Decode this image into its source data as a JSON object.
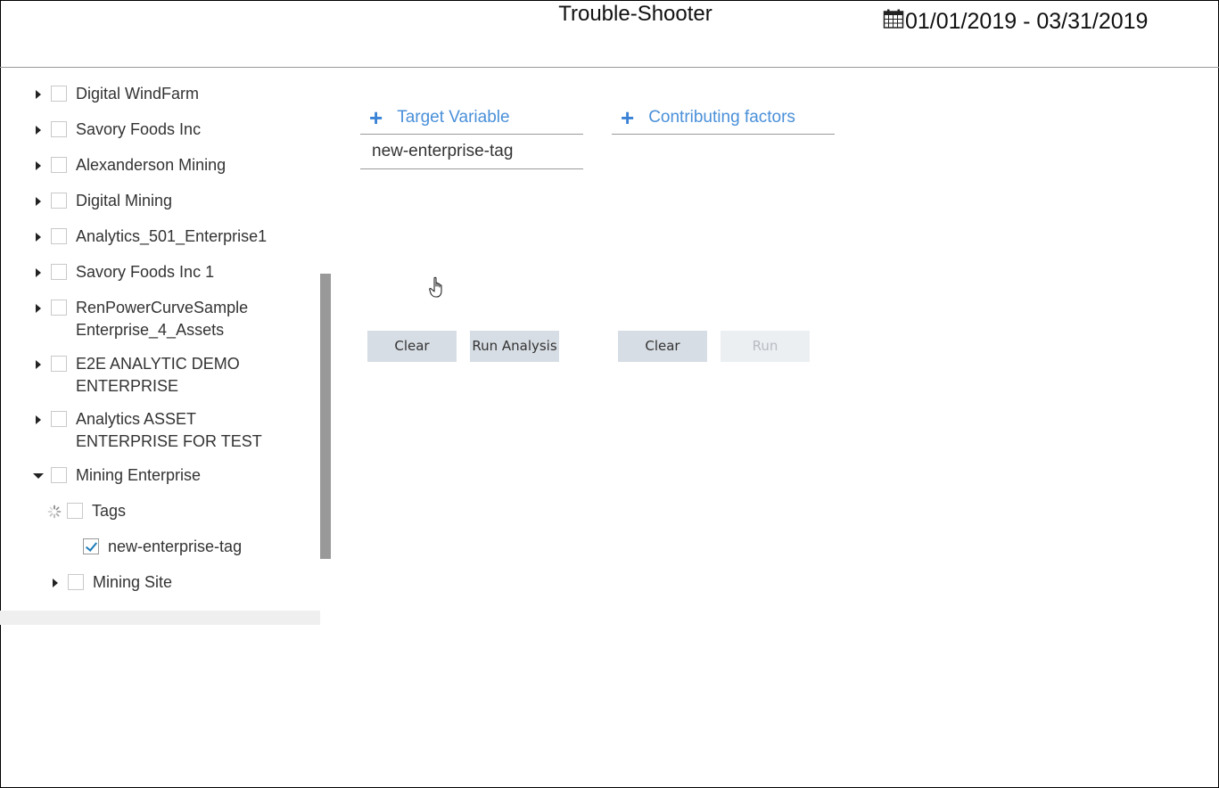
{
  "header": {
    "title": "Trouble-Shooter",
    "date_range": "01/01/2019 - 03/31/2019"
  },
  "tree": {
    "items": [
      {
        "label": "Digital WindFarm",
        "checked": false,
        "expanded": false
      },
      {
        "label": "Savory Foods Inc",
        "checked": false,
        "expanded": false
      },
      {
        "label": "Alexanderson Mining",
        "checked": false,
        "expanded": false
      },
      {
        "label": "Digital Mining",
        "checked": false,
        "expanded": false
      },
      {
        "label": "Analytics_501_Enterprise1",
        "checked": false,
        "expanded": false
      },
      {
        "label": "Savory Foods Inc 1",
        "checked": false,
        "expanded": false
      },
      {
        "label": "RenPowerCurveSample Enterprise_4_Assets",
        "line1": "RenPowerCurveSample",
        "line2": "Enterprise_4_Assets",
        "checked": false,
        "expanded": false
      },
      {
        "label": "E2E ANALYTIC DEMO ENTERPRISE",
        "line1": "E2E ANALYTIC DEMO",
        "line2": "ENTERPRISE",
        "checked": false,
        "expanded": false
      },
      {
        "label": "Analytics ASSET ENTERPRISE FOR TEST",
        "line1": "Analytics ASSET",
        "line2": "ENTERPRISE FOR TEST",
        "checked": false,
        "expanded": false
      },
      {
        "label": "Mining Enterprise",
        "checked": false,
        "expanded": true
      },
      {
        "label": "Tags",
        "checked": false,
        "loading": true
      },
      {
        "label": "new-enterprise-tag",
        "checked": true
      },
      {
        "label": "Mining Site",
        "checked": false,
        "expanded": false
      }
    ]
  },
  "target_panel": {
    "header": "Target Variable",
    "items": [
      "new-enterprise-tag"
    ],
    "clear_label": "Clear",
    "run_label": "Run Analysis"
  },
  "contributing_panel": {
    "header": "Contributing factors",
    "items": [],
    "clear_label": "Clear",
    "run_label": "Run"
  },
  "colors": {
    "accent": "#4a90d9",
    "button_bg": "#d7dde4",
    "button_disabled_bg": "#eceff2",
    "scrollbar_thumb": "#999999"
  }
}
